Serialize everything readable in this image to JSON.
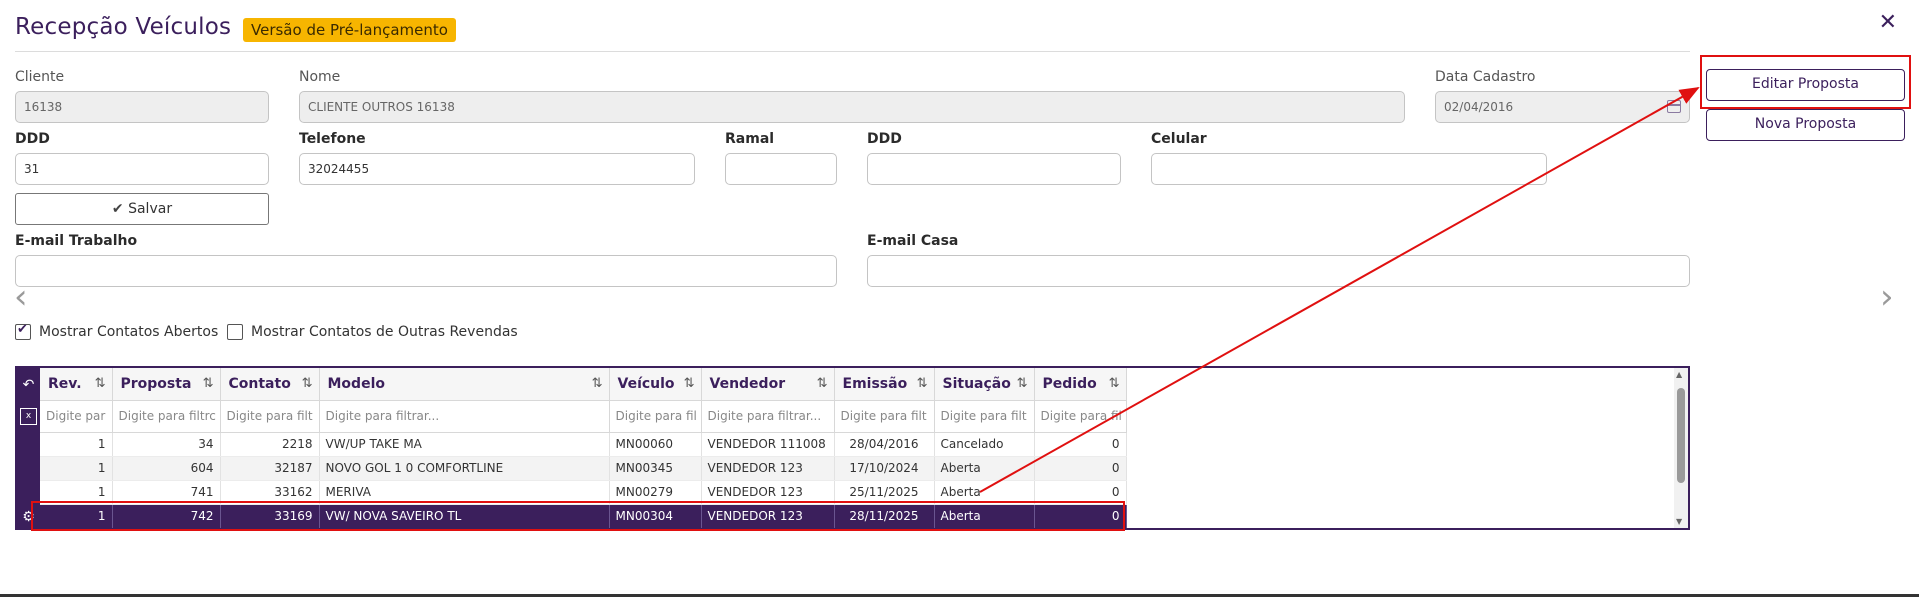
{
  "header": {
    "title": "Recepção Veículos",
    "badge": "Versão de Pré-lançamento",
    "close_icon": "✕"
  },
  "form": {
    "cliente_label": "Cliente",
    "cliente_value": "16138",
    "nome_label": "Nome",
    "nome_value": "CLIENTE OUTROS 16138",
    "data_label": "Data Cadastro",
    "data_value": "02/04/2016",
    "ddd_label": "DDD",
    "ddd_value": "31",
    "telefone_label": "Telefone",
    "telefone_value": "32024455",
    "ramal_label": "Ramal",
    "ramal_value": "",
    "ddd2_label": "DDD",
    "ddd2_value": "",
    "celular_label": "Celular",
    "celular_value": "",
    "save_label": "Salvar",
    "email_trabalho_label": "E-mail Trabalho",
    "email_trabalho_value": "",
    "email_casa_label": "E-mail Casa",
    "email_casa_value": ""
  },
  "actions": {
    "editar": "Editar Proposta",
    "nova": "Nova Proposta"
  },
  "filters": {
    "abertos_label": "Mostrar Contatos Abertos",
    "abertos_checked": true,
    "outras_label": "Mostrar Contatos de Outras Revendas",
    "outras_checked": false
  },
  "grid": {
    "columns": [
      "Rev.",
      "Proposta",
      "Contato",
      "Modelo",
      "Veículo",
      "Vendedor",
      "Emissão",
      "Situação",
      "Pedido"
    ],
    "filters": [
      "Digite par",
      "Digite para filtrc",
      "Digite para filt",
      "Digite para filtrar...",
      "Digite para fil",
      "Digite para filtrar...",
      "Digite para filt",
      "Digite para filt",
      "Digite para fil"
    ],
    "rows": [
      [
        "1",
        "34",
        "2218",
        "VW/UP TAKE MA",
        "MN00060",
        "VENDEDOR 111008",
        "28/04/2016",
        "Cancelado",
        "0"
      ],
      [
        "1",
        "604",
        "32187",
        "NOVO GOL 1 0 COMFORTLINE",
        "MN00345",
        "VENDEDOR 123",
        "17/10/2024",
        "Aberta",
        "0"
      ],
      [
        "1",
        "741",
        "33162",
        "MERIVA",
        "MN00279",
        "VENDEDOR 123",
        "25/11/2025",
        "Aberta",
        "0"
      ],
      [
        "1",
        "742",
        "33169",
        "VW/ NOVA SAVEIRO TL",
        "MN00304",
        "VENDEDOR 123",
        "28/11/2025",
        "Aberta",
        "0"
      ]
    ],
    "selected_row": 3
  },
  "colors": {
    "brand": "#3b1f5c",
    "badge": "#f7b500",
    "highlight": "#e01010"
  }
}
